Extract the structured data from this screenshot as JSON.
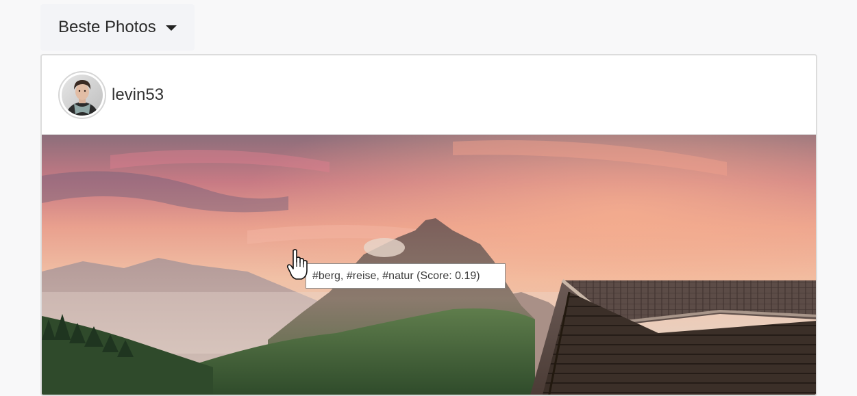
{
  "filter_dropdown": {
    "label": "Beste Photos",
    "icon": "caret-down-icon"
  },
  "post": {
    "username": "levin53",
    "avatar_icon": "user-avatar",
    "photo_description_icon": "mountain-landscape-photo",
    "tooltip": "#berg, #reise, #natur (Score: 0.19)"
  },
  "colors": {
    "background": "#f8f8f9",
    "card_border": "#dcdcdc",
    "dropdown_bg": "#f3f4f7",
    "text": "#2a2a2a"
  }
}
